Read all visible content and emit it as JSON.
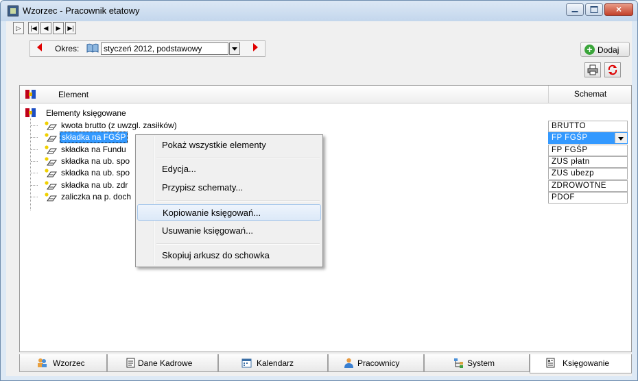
{
  "window": {
    "title": "Wzorzec - Pracownik etatowy",
    "controls": [
      "minimize",
      "maximize",
      "close"
    ]
  },
  "nav": {
    "buttons": [
      "first-record-icon",
      "first-icon",
      "prev-icon",
      "next-icon",
      "last-icon"
    ]
  },
  "okres": {
    "label": "Okres:",
    "value": "styczeń 2012, podstawowy"
  },
  "toolbar": {
    "add_label": "Dodaj",
    "icons": [
      "plus-icon",
      "printer-icon",
      "refresh-icon"
    ]
  },
  "grid": {
    "header_element": "Element",
    "header_schemat": "Schemat",
    "root_label": "Elementy księgowane",
    "items": [
      {
        "label": "kwota brutto (z uwzgl. zasiłków)",
        "schemat": "BRUTTO",
        "selected": false
      },
      {
        "label": "składka na FGŚP",
        "schemat": "FP FGŚP",
        "selected": true
      },
      {
        "label": "składka na Fundusz Pracy",
        "schemat": "FP FGŚP",
        "selected": false
      },
      {
        "label": "składka na ub. społeczne pł. przez pracodawcę",
        "schemat": "ZUS płatn",
        "selected": false
      },
      {
        "label": "składka na ub. społeczne pł. przez pracownika",
        "schemat": "ZUS ubezp",
        "selected": false
      },
      {
        "label": "składka na ub. zdrowotne",
        "schemat": "ZDROWOTNE",
        "selected": false
      },
      {
        "label": "zaliczka na p. dochodowy",
        "schemat": "PDOF",
        "selected": false
      }
    ],
    "visible_labels": [
      "kwota brutto (z uwzgl. zasiłków)",
      "składka na FGŚP",
      "składka na Fundu",
      "składka na ub. spo",
      "składka na ub. spo",
      "składka na ub. zdr",
      "zaliczka na p. doch"
    ]
  },
  "context_menu": {
    "items": [
      "Pokaż wszystkie elementy",
      "Edycja...",
      "Przypisz schematy...",
      "Kopiowanie księgowań...",
      "Usuwanie księgowań...",
      "Skopiuj arkusz do schowka"
    ],
    "highlighted": "Kopiowanie księgowań..."
  },
  "tabs": [
    {
      "label": "Wzorzec",
      "icon": "people-icon",
      "active": false
    },
    {
      "label": "Dane Kadrowe",
      "icon": "document-icon",
      "active": false
    },
    {
      "label": "Kalendarz",
      "icon": "calendar-icon",
      "active": false
    },
    {
      "label": "Pracownicy",
      "icon": "person-icon",
      "active": false
    },
    {
      "label": "System",
      "icon": "hierarchy-icon",
      "active": false
    },
    {
      "label": "Księgowanie",
      "icon": "ledger-icon",
      "active": true
    }
  ],
  "colors": {
    "selection": "#3399ff",
    "nav_arrow": "#e00000",
    "add_icon": "#3aa53a"
  }
}
